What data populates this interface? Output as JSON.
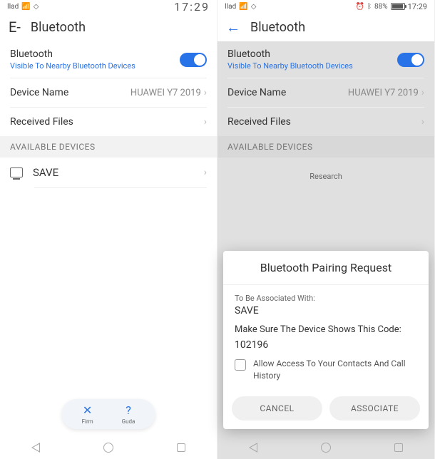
{
  "left": {
    "status": {
      "carrier": "Ilad",
      "time": "17:29"
    },
    "header": {
      "back": "E-",
      "title": "Bluetooth"
    },
    "bluetooth": {
      "label": "Bluetooth",
      "sublabel": "Visible To Nearby Bluetooth Devices"
    },
    "device_name": {
      "label": "Device Name",
      "value": "HUAWEI Y7 2019"
    },
    "received": {
      "label": "Received Files"
    },
    "available_header": "AVAILABLE DEVICES",
    "device": {
      "name": "SAVE"
    },
    "pill": {
      "close": "Firm",
      "help": "Guda"
    }
  },
  "right": {
    "status": {
      "carrier": "Ilad",
      "battery_pct": "88%",
      "time": "17:29"
    },
    "header": {
      "title": "Bluetooth"
    },
    "bluetooth": {
      "label": "Bluetooth",
      "sublabel": "Visible To Nearby Bluetooth Devices"
    },
    "device_name": {
      "label": "Device Name",
      "value": "HUAWEI Y7 2019"
    },
    "received": {
      "label": "Received Files"
    },
    "available_header": "AVAILABLE DEVICES",
    "researching": "Research",
    "dialog": {
      "title": "Bluetooth Pairing Request",
      "assoc_label": "To Be Associated With:",
      "assoc_device": "SAVE",
      "message": "Make Sure The Device Shows This Code:",
      "code": "102196",
      "checkbox": "Allow Access To Your Contacts And Call History",
      "cancel": "CANCEL",
      "associate": "ASSOCIATE"
    }
  }
}
